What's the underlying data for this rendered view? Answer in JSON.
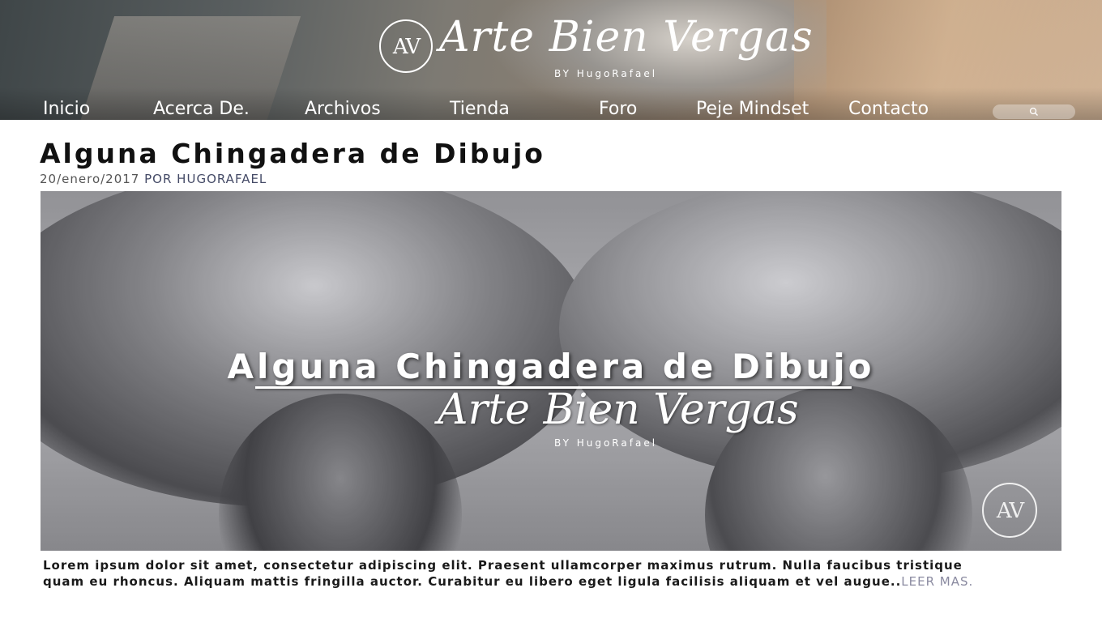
{
  "brand": {
    "logo_monogram": "AV",
    "logo_script": "Arte Bien Vergas",
    "logo_byline": "BY HugoRafael"
  },
  "nav": {
    "items": [
      {
        "label": "Inicio"
      },
      {
        "label": "Acerca De."
      },
      {
        "label": "Archivos"
      },
      {
        "label": "Tienda"
      },
      {
        "label": "Foro"
      },
      {
        "label": "Peje Mindset"
      },
      {
        "label": "Contacto"
      }
    ],
    "search_icon": "search-icon"
  },
  "post": {
    "title": "Alguna Chingadera de Dibujo",
    "date": "20/enero/2017",
    "author": "POR HUGORAFAEL",
    "feature": {
      "overlay_title": "Alguna Chingadera de Dibujo",
      "overlay_script": "Arte Bien Vergas",
      "overlay_byline": "BY HugoRafael",
      "badge_monogram": "AV"
    },
    "excerpt": "Lorem ipsum dolor sit amet, consectetur adipiscing elit. Praesent ullamcorper maximus rutrum. Nulla faucibus tristique quam eu rhoncus. Aliquam mattis fringilla auctor. Curabitur eu libero eget ligula facilisis aliquam et vel augue..",
    "read_more": "LEER MAS."
  },
  "colors": {
    "read_more": "#8a8aa0",
    "author": "#444a66"
  }
}
